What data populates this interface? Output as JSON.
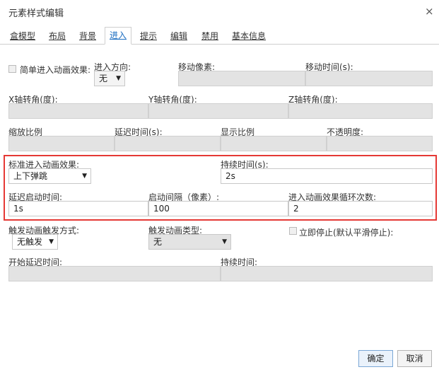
{
  "dialog": {
    "title": "元素样式编辑",
    "close_glyph": "×"
  },
  "tabs": [
    {
      "label": "盒模型"
    },
    {
      "label": "布局"
    },
    {
      "label": "背景"
    },
    {
      "label": "进入",
      "active": true
    },
    {
      "label": "提示"
    },
    {
      "label": "编辑"
    },
    {
      "label": "禁用"
    },
    {
      "label": "基本信息"
    }
  ],
  "simple": {
    "checkbox_label": "简单进入动画效果:",
    "direction_label": "进入方向:",
    "direction_value": "无",
    "move_px_label": "移动像素:",
    "move_time_label": "移动时间(s):"
  },
  "rotate": {
    "x_label": "X轴转角(度):",
    "y_label": "Y轴转角(度):",
    "z_label": "Z轴转角(度):"
  },
  "scale_row": {
    "scale_label": "缩放比例",
    "delay_label": "延迟时间(s):",
    "show_label": "显示比例",
    "opacity_label": "不透明度:"
  },
  "standard": {
    "effect_label": "标准进入动画效果:",
    "effect_value": "上下弹跳",
    "duration_label": "持续时间(s):",
    "duration_value": "2s",
    "delay_start_label": "延迟启动时间:",
    "delay_start_value": "1s",
    "interval_label": "启动间隔（像素）:",
    "interval_value": "100",
    "loop_label": "进入动画效果循环次数:",
    "loop_value": "2"
  },
  "trigger": {
    "mode_label": "触发动画触发方式:",
    "mode_value": "无触发",
    "type_label": "触发动画类型:",
    "type_value": "无",
    "stop_label": "立即停止(默认平滑停止):",
    "start_delay_label": "开始延迟时间:",
    "duration_label": "持续时间:"
  },
  "buttons": {
    "ok": "确定",
    "cancel": "取消"
  },
  "colors": {
    "highlight_border": "#e53935",
    "active_tab_text": "#1e6fc2"
  }
}
